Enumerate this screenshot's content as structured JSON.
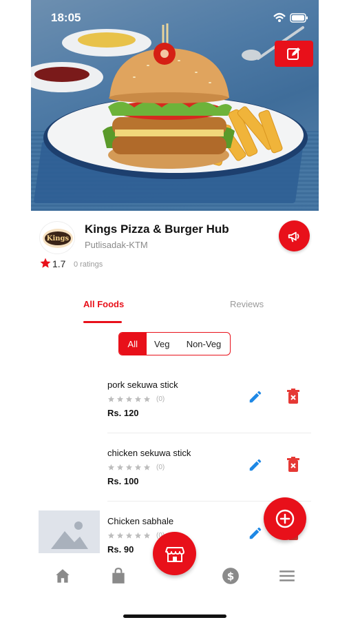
{
  "status_bar": {
    "time": "18:05"
  },
  "store": {
    "name": "Kings Pizza & Burger Hub",
    "location": "Putlisadak-KTM",
    "rating": "1.7",
    "ratings_count": "0 ratings",
    "logo_text": "Kings"
  },
  "tabs": [
    {
      "label": "All Foods",
      "active": true
    },
    {
      "label": "Reviews",
      "active": false
    }
  ],
  "filter": {
    "options": [
      "All",
      "Veg",
      "Non-Veg"
    ],
    "selected": "All"
  },
  "foods": [
    {
      "name": "pork sekuwa stick",
      "rating_count": "(0)",
      "price": "Rs. 120"
    },
    {
      "name": "chicken sekuwa stick",
      "rating_count": "(0)",
      "price": "Rs. 100"
    },
    {
      "name": "Chicken sabhale",
      "rating_count": "(0)",
      "price": "Rs. 90"
    }
  ],
  "bottom_nav": [
    "home-icon",
    "bag-icon",
    "store-icon",
    "dollar-icon",
    "menu-icon"
  ],
  "colors": {
    "accent": "#e8101a",
    "edit_blue": "#1e88e5",
    "nav_gray": "#8a8a8a"
  }
}
